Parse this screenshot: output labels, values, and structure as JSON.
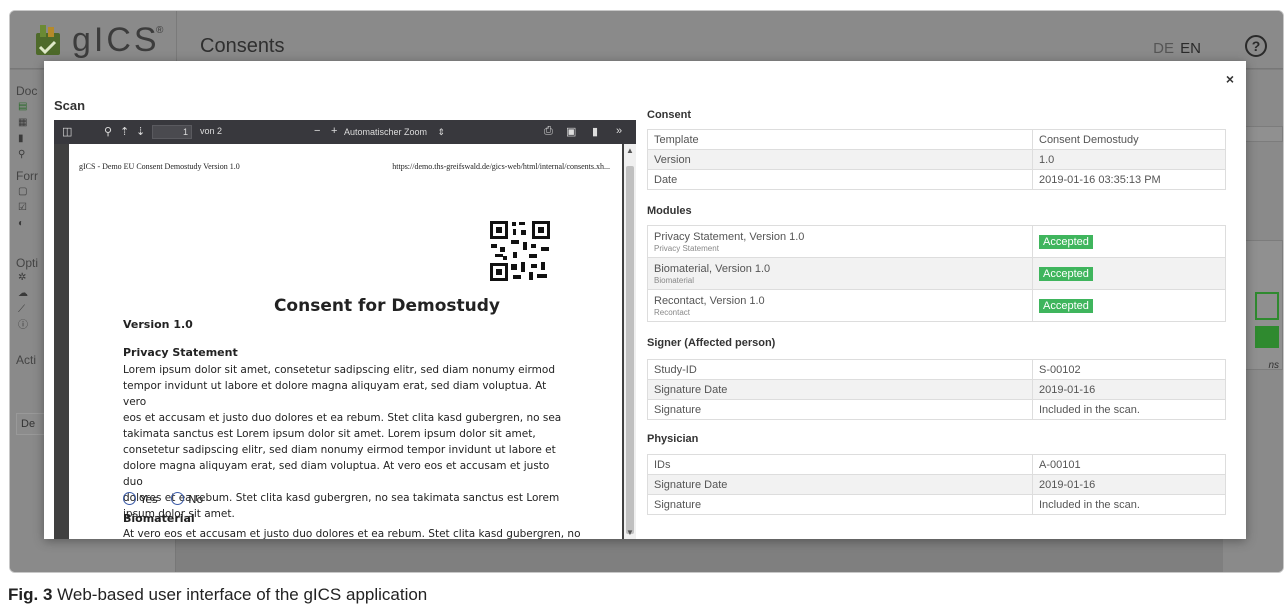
{
  "app": {
    "logo_text": "gICS",
    "logo_reg": "®",
    "title": "Consents",
    "lang_de": "DE",
    "lang_en": "EN",
    "help": "?"
  },
  "sidebar": {
    "sections": [
      "Doc",
      "Forr",
      "Opti",
      "Acti"
    ],
    "button": "De"
  },
  "right_panel": {
    "text": "ns"
  },
  "modal": {
    "close": "×",
    "scan_title": "Scan",
    "viewer": {
      "page_number": "1",
      "page_of": "von 2",
      "zoom": "Automatischer Zoom",
      "header_left": "gICS - Demo EU Consent Demostudy Version 1.0",
      "header_right": "https://demo.ths-greifswald.de/gics-web/html/internal/consents.xh...",
      "doc_title": "Consent for Demostudy",
      "doc_version": "Version 1.0",
      "section1": "Privacy Statement",
      "body_lines": [
        "Lorem ipsum dolor sit amet, consetetur sadipscing elitr, sed diam nonumy eirmod",
        "tempor invidunt ut labore et dolore magna aliquyam erat, sed diam voluptua. At vero",
        "eos et accusam et justo duo dolores et ea rebum. Stet clita kasd gubergren, no sea",
        "takimata sanctus est Lorem ipsum dolor sit amet. Lorem ipsum dolor sit amet,",
        "consetetur sadipscing elitr, sed diam nonumy eirmod tempor invidunt ut labore et",
        "dolore magna aliquyam erat, sed diam voluptua. At vero eos et accusam et justo duo",
        "dolores et ea rebum. Stet clita kasd gubergren, no sea takimata sanctus est Lorem",
        "ipsum dolor sit amet."
      ],
      "radio_yes": "Yes",
      "radio_no": "No",
      "section2": "Biomaterial",
      "cut_line": "At vero eos et accusam et justo duo dolores et ea rebum. Stet clita kasd gubergren, no"
    },
    "consent": {
      "title": "Consent",
      "rows": [
        {
          "label": "Template",
          "value": "Consent Demostudy"
        },
        {
          "label": "Version",
          "value": "1.0"
        },
        {
          "label": "Date",
          "value": "2019-01-16 03:35:13 PM"
        }
      ]
    },
    "modules": {
      "title": "Modules",
      "rows": [
        {
          "label": "Privacy Statement, Version 1.0",
          "sub": "Privacy Statement",
          "status": "Accepted"
        },
        {
          "label": "Biomaterial, Version 1.0",
          "sub": "Biomaterial",
          "status": "Accepted"
        },
        {
          "label": "Recontact, Version 1.0",
          "sub": "Recontact",
          "status": "Accepted"
        }
      ]
    },
    "signer": {
      "title": "Signer (Affected person)",
      "rows": [
        {
          "label": "Study-ID",
          "value": "S-00102"
        },
        {
          "label": "Signature Date",
          "value": "2019-01-16"
        },
        {
          "label": "Signature",
          "value": "Included in the scan."
        }
      ]
    },
    "physician": {
      "title": "Physician",
      "rows": [
        {
          "label": "IDs",
          "value": "A-00101"
        },
        {
          "label": "Signature Date",
          "value": "2019-01-16"
        },
        {
          "label": "Signature",
          "value": "Included in the scan."
        }
      ]
    }
  },
  "caption": {
    "label": "Fig. 3",
    "text": "Web-based user interface of the gICS application"
  },
  "colors": {
    "accepted_badge": "#3fb55d",
    "overlay": "#7f7f7f",
    "viewer_toolbar": "#38383d"
  }
}
